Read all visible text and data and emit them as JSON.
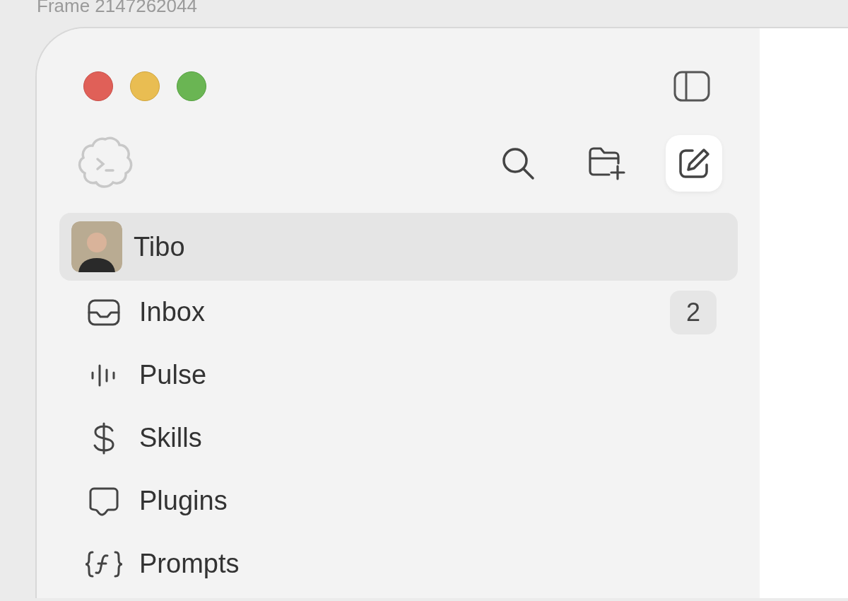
{
  "frame_label": "Frame 2147262044",
  "sidebar": {
    "items": [
      {
        "kind": "profile",
        "label": "Tibo",
        "selected": true
      },
      {
        "kind": "inbox",
        "label": "Inbox",
        "selected": false,
        "badge": "2"
      },
      {
        "kind": "pulse",
        "label": "Pulse",
        "selected": false
      },
      {
        "kind": "skills",
        "label": "Skills",
        "selected": false
      },
      {
        "kind": "plugins",
        "label": "Plugins",
        "selected": false
      },
      {
        "kind": "prompts",
        "label": "Prompts",
        "selected": false
      }
    ]
  }
}
